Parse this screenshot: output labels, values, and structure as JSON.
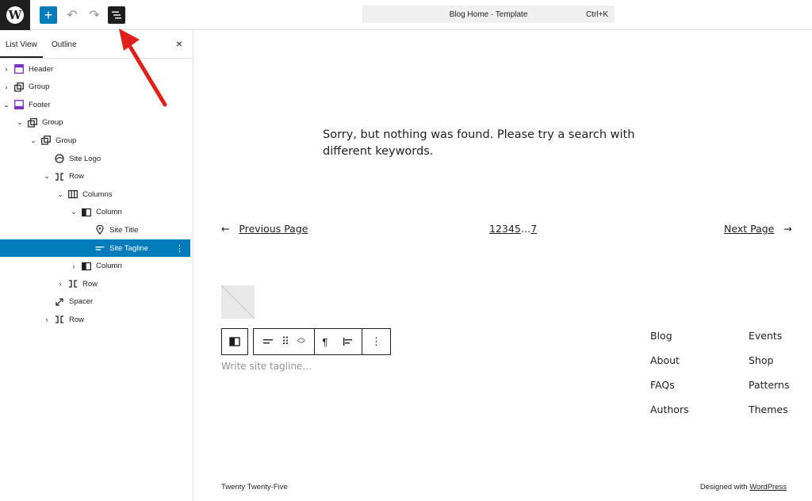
{
  "topbar": {
    "logo_letter": "W",
    "add_icon": "+",
    "undo_icon": "↶",
    "redo_icon": "↷",
    "command_title": "Blog Home · Template",
    "command_shortcut": "Ctrl+K"
  },
  "sidebar": {
    "tabs": [
      "List View",
      "Outline"
    ],
    "close_icon": "×",
    "items": [
      {
        "label": "Header",
        "icon": "header-template-icon",
        "depth": 0,
        "expand": "›"
      },
      {
        "label": "Group",
        "icon": "group-icon",
        "depth": 0,
        "expand": "›"
      },
      {
        "label": "Footer",
        "icon": "footer-template-icon",
        "depth": 0,
        "expand": "⌄"
      },
      {
        "label": "Group",
        "icon": "group-icon",
        "depth": 1,
        "expand": "⌄"
      },
      {
        "label": "Group",
        "icon": "group-icon",
        "depth": 2,
        "expand": "⌄"
      },
      {
        "label": "Site Logo",
        "icon": "site-logo-icon",
        "depth": 3,
        "expand": ""
      },
      {
        "label": "Row",
        "icon": "row-icon",
        "depth": 3,
        "expand": "⌄"
      },
      {
        "label": "Columns",
        "icon": "columns-icon",
        "depth": 4,
        "expand": "⌄"
      },
      {
        "label": "Column",
        "icon": "column-icon",
        "depth": 5,
        "expand": "⌄"
      },
      {
        "label": "Site Title",
        "icon": "map-marker-icon",
        "depth": 6,
        "expand": ""
      },
      {
        "label": "Site Tagline",
        "icon": "tagline-icon",
        "depth": 6,
        "expand": "",
        "selected": true
      },
      {
        "label": "Column",
        "icon": "column-icon",
        "depth": 5,
        "expand": "›"
      },
      {
        "label": "Row",
        "icon": "row-icon",
        "depth": 4,
        "expand": "›"
      },
      {
        "label": "Spacer",
        "icon": "spacer-icon",
        "depth": 3,
        "expand": ""
      },
      {
        "label": "Row",
        "icon": "row-icon",
        "depth": 3,
        "expand": "›"
      }
    ],
    "kebab_icon": "⋮"
  },
  "canvas": {
    "not_found_text": "Sorry, but nothing was found. Please try a search with different keywords.",
    "pagination": {
      "prev_arrow": "←",
      "prev_label": "Previous Page",
      "numbers": [
        "1",
        "2",
        "3",
        "4",
        "5",
        "…",
        "7"
      ],
      "next_label": "Next Page",
      "next_arrow": "→"
    },
    "tagline_placeholder": "Write site tagline…",
    "nav_col1": [
      "Blog",
      "About",
      "FAQs",
      "Authors"
    ],
    "nav_col2": [
      "Events",
      "Shop",
      "Patterns",
      "Themes"
    ],
    "footer_left": "Twenty Twenty-Five",
    "footer_right_prefix": "Designed with ",
    "footer_right_link": "WordPress"
  },
  "colors": {
    "accent": "#007cba",
    "annotation_arrow": "#e0201b",
    "dark": "#1e1e1e"
  }
}
